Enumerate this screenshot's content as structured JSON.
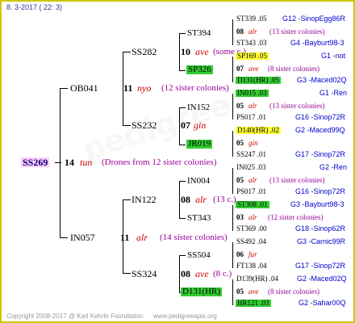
{
  "header": {
    "date": "8. 3-2017 ( 22: 3)"
  },
  "footer": {
    "copyright": "Copyright 2008-2017 @ Karl Kehrle Foundation.",
    "site": "www.pedigreeapis.org"
  },
  "root": {
    "id": "SS269",
    "num": "14",
    "name": "tun",
    "desc": "(Drones from 12 sister colonies)"
  },
  "gen1": [
    {
      "id": "OB041",
      "num": "11",
      "name": "nyo",
      "desc": "(12 sister colonies)"
    },
    {
      "id": "IN057",
      "num": "11",
      "name": "alr",
      "desc": "(14 sister colonies)"
    }
  ],
  "gen2": [
    {
      "id": "SS282",
      "num": "10",
      "name": "ave",
      "desc": "(some c.)"
    },
    {
      "id": "SS232",
      "num": "07",
      "name": "gin",
      "desc": ""
    },
    {
      "id": "IN122",
      "num": "08",
      "name": "alr",
      "desc": "(13 c.)"
    },
    {
      "id": "SS324",
      "num": "08",
      "name": "ave",
      "desc": "(8 c.)"
    }
  ],
  "gen3": [
    {
      "id": "ST394"
    },
    {
      "id": "SP326"
    },
    {
      "id": "IN152"
    },
    {
      "id": "JR019"
    },
    {
      "id": "IN004"
    },
    {
      "id": "ST343"
    },
    {
      "id": "SS504"
    },
    {
      "id": "D131(HR)"
    }
  ],
  "right": [
    {
      "id": "ST339 .05",
      "src": "G12 -SinopEgg86R"
    },
    {
      "num": "08",
      "name": "alr",
      "desc": "(13 sister colonies)"
    },
    {
      "id": "ST343 .03",
      "src": "G4 -Bayburt98-3"
    },
    {
      "id": "SP169 .05",
      "src": "G1 -not"
    },
    {
      "num": "07",
      "name": "ave",
      "desc": "(8 sister colonies)"
    },
    {
      "id": "D131(HR) .05",
      "src": "G3 -Maced02Q"
    },
    {
      "id": "IN015 .03",
      "src": "G1 -Ren"
    },
    {
      "num": "05",
      "name": "alr",
      "desc": "(13 sister colonies)"
    },
    {
      "id": "PS017 .01",
      "src": "G16 -Sinop72R"
    },
    {
      "id": "D140(HR) .02",
      "src": "G2 -Maced99Q"
    },
    {
      "num": "05",
      "name": "gin",
      "desc": ""
    },
    {
      "id": "SS247 .01",
      "src": "G17 -Sinop72R"
    },
    {
      "id": "IN025 .03",
      "src": "G2 -Ren"
    },
    {
      "num": "05",
      "name": "alr",
      "desc": "(13 sister colonies)"
    },
    {
      "id": "PS017 .01",
      "src": "G16 -Sinop72R"
    },
    {
      "id": "ST308 .01",
      "src": "G3 -Bayburt98-3"
    },
    {
      "num": "03",
      "name": "alr",
      "desc": "(12 sister colonies)"
    },
    {
      "id": "ST369 .00",
      "src": "G18 -Sinop62R"
    },
    {
      "id": "SS492 .04",
      "src": "G3 -Carnic99R"
    },
    {
      "num": "06",
      "name": "fur",
      "desc": ""
    },
    {
      "id": "FT138 .04",
      "src": "G17 -Sinop72R"
    },
    {
      "id": "D139(HR) .04",
      "src": "G2 -Maced02Q"
    },
    {
      "num": "05",
      "name": "ave",
      "desc": "(8 sister colonies)"
    },
    {
      "id": "HR121 .03",
      "src": "G2 -Sahar00Q"
    }
  ],
  "colors": {
    "frame": "#ccc600",
    "green": "#33cc33",
    "yellow": "#ffff33",
    "root": "#ffccff",
    "blue": "#0000cc",
    "red": "#cc0000",
    "purple": "#990099"
  }
}
